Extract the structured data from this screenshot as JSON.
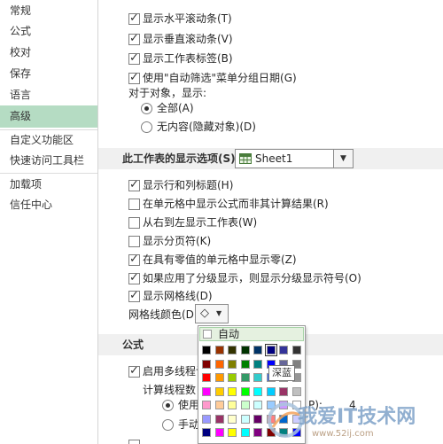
{
  "sidebar": {
    "items": [
      {
        "label": "常规"
      },
      {
        "label": "公式"
      },
      {
        "label": "校对"
      },
      {
        "label": "保存"
      },
      {
        "label": "语言"
      },
      {
        "label": "高级"
      },
      {
        "label": "自定义功能区"
      },
      {
        "label": "快速访问工具栏"
      },
      {
        "label": "加载项"
      },
      {
        "label": "信任中心"
      }
    ],
    "active_index": 5
  },
  "workbook_options": {
    "show_hscroll": {
      "label": "显示水平滚动条(T)",
      "checked": true
    },
    "show_vscroll": {
      "label": "显示垂直滚动条(V)",
      "checked": true
    },
    "show_sheet_tabs": {
      "label": "显示工作表标签(B)",
      "checked": true
    },
    "group_dates": {
      "label": "使用\"自动筛选\"菜单分组日期(G)",
      "checked": true
    },
    "objects_label": "对于对象，显示:",
    "all_radio": {
      "label": "全部(A)",
      "checked": true
    },
    "none_radio": {
      "label": "无内容(隐藏对象)(D)",
      "checked": false
    }
  },
  "sheet_section": {
    "title": "此工作表的显示选项(S):",
    "sheet_select": "Sheet1",
    "options": [
      {
        "label": "显示行和列标题(H)",
        "checked": true
      },
      {
        "label": "在单元格中显示公式而非其计算结果(R)",
        "checked": false
      },
      {
        "label": "从右到左显示工作表(W)",
        "checked": false
      },
      {
        "label": "显示分页符(K)",
        "checked": false
      },
      {
        "label": "在具有零值的单元格中显示零(Z)",
        "checked": true
      },
      {
        "label": "如果应用了分级显示，则显示分级显示符号(O)",
        "checked": true
      },
      {
        "label": "显示网格线(D)",
        "checked": true
      }
    ],
    "gridline_color_label": "网格线颜色(D)"
  },
  "formula_section": {
    "title": "公式",
    "multithread_label": "启用多线程计",
    "multithread_checked": true,
    "thread_count_label": "计算线程数",
    "use_radio_label": "使用",
    "use_radio_checked": true,
    "hidden_suffix": "P):",
    "thread_count_value": "4",
    "manual_radio_label": "手动"
  },
  "color_popup": {
    "auto_label": "自动",
    "tooltip": "深蓝",
    "selected_index": 5,
    "colors": [
      "#000000",
      "#993300",
      "#333300",
      "#003300",
      "#003366",
      "#000080",
      "#333399",
      "#333333",
      "#800000",
      "#ff6600",
      "#808000",
      "#008000",
      "#008080",
      "#0000ff",
      "#666699",
      "#808080",
      "#ff0000",
      "#ff9900",
      "#99cc00",
      "#339966",
      "#33cccc",
      "#3366ff",
      "#800080",
      "#969696",
      "#ff00ff",
      "#ffcc00",
      "#ffff00",
      "#00ff00",
      "#00ffff",
      "#00ccff",
      "#993366",
      "#c0c0c0",
      "#ff99cc",
      "#ffcc99",
      "#ffff99",
      "#ccffcc",
      "#ccffff",
      "#99ccff",
      "#cc99ff",
      "#ffffff",
      "#9999ff",
      "#993366",
      "#ffffcc",
      "#ccffff",
      "#660066",
      "#ff8080",
      "#0066cc",
      "#ccccff",
      "#000080",
      "#ff00ff",
      "#ffff00",
      "#00ffff",
      "#800080",
      "#800000",
      "#008080",
      "#0000ff"
    ]
  },
  "watermark": {
    "main": "我爱IT技术网",
    "url": "www.52ij.com"
  },
  "accent_colors": {
    "active_nav": "#b5dcc3",
    "auto_row": "#e5f1e0"
  }
}
